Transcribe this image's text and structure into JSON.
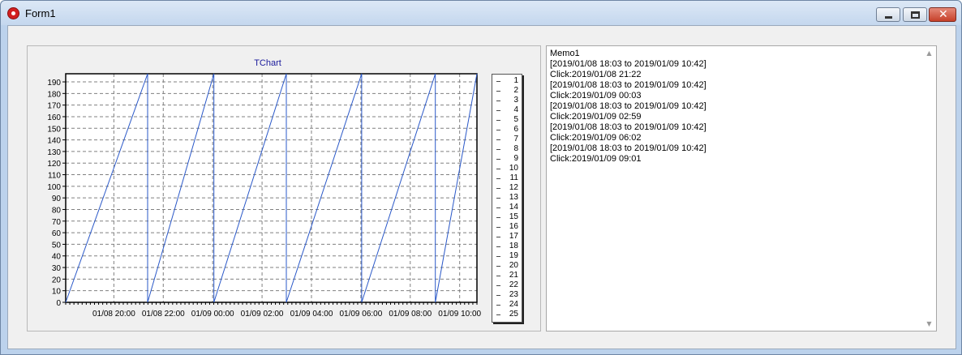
{
  "window": {
    "title": "Form1",
    "buttons": {
      "minimize": "minimize",
      "maximize": "maximize",
      "close": "✕"
    }
  },
  "chart": {
    "title": "TChart",
    "chart_data": {
      "type": "line",
      "title": "TChart",
      "xlabel": "",
      "ylabel": "",
      "ylim": [
        0,
        197
      ],
      "yticks": [
        0,
        10,
        20,
        30,
        40,
        50,
        60,
        70,
        80,
        90,
        100,
        110,
        120,
        130,
        140,
        150,
        160,
        170,
        180,
        190
      ],
      "xticks": [
        "01/08 20:00",
        "01/08 22:00",
        "01/09 00:00",
        "01/09 02:00",
        "01/09 04:00",
        "01/09 06:00",
        "01/09 08:00",
        "01/09 10:00"
      ],
      "xrange": [
        "2019/01/08 18:03",
        "2019/01/09 10:42"
      ],
      "grid": true,
      "legend_position": "right",
      "series": [
        {
          "values": [
            {
              "x": "2019/01/08 18:03",
              "y": 0
            },
            {
              "x": "2019/01/08 21:22",
              "y": 197
            },
            {
              "x": "2019/01/08 21:22",
              "y": 0
            },
            {
              "x": "2019/01/09 00:03",
              "y": 197
            },
            {
              "x": "2019/01/09 00:03",
              "y": 0
            },
            {
              "x": "2019/01/09 02:59",
              "y": 197
            },
            {
              "x": "2019/01/09 02:59",
              "y": 0
            },
            {
              "x": "2019/01/09 06:02",
              "y": 197
            },
            {
              "x": "2019/01/09 06:02",
              "y": 0
            },
            {
              "x": "2019/01/09 09:01",
              "y": 197
            },
            {
              "x": "2019/01/09 09:01",
              "y": 0
            },
            {
              "x": "2019/01/09 10:42",
              "y": 197
            }
          ]
        }
      ],
      "colors": {
        "line": "#2a58c8",
        "grid": "#808080",
        "title": "#1a1a9c"
      }
    },
    "legend_items": [
      "1",
      "2",
      "3",
      "4",
      "5",
      "6",
      "7",
      "8",
      "9",
      "10",
      "11",
      "12",
      "13",
      "14",
      "15",
      "16",
      "17",
      "18",
      "19",
      "20",
      "21",
      "22",
      "23",
      "24",
      "25"
    ]
  },
  "memo": {
    "lines": [
      "Memo1",
      "[2019/01/08 18:03 to 2019/01/09 10:42]",
      "Click:2019/01/08 21:22",
      "[2019/01/08 18:03 to 2019/01/09 10:42]",
      "Click:2019/01/09 00:03",
      "[2019/01/08 18:03 to 2019/01/09 10:42]",
      "Click:2019/01/09 02:59",
      "[2019/01/08 18:03 to 2019/01/09 10:42]",
      "Click:2019/01/09 06:02",
      "[2019/01/08 18:03 to 2019/01/09 10:42]",
      "Click:2019/01/09 09:01"
    ],
    "scroll_up_icon": "▲",
    "scroll_down_icon": "▼"
  }
}
